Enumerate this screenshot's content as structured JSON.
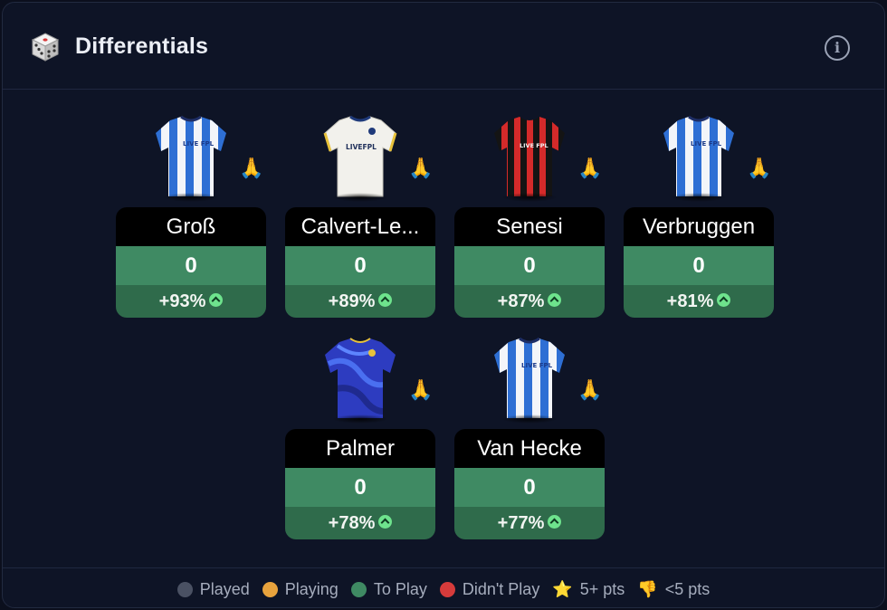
{
  "header": {
    "title": "Differentials",
    "icon": "dice-icon",
    "info_label": "i"
  },
  "players": [
    {
      "name": "Groß",
      "points": "0",
      "change": "+93%",
      "kit": "blue-white-stripes",
      "badge": "🙏"
    },
    {
      "name": "Calvert-Le...",
      "points": "0",
      "change": "+89%",
      "kit": "white",
      "badge": "🙏"
    },
    {
      "name": "Senesi",
      "points": "0",
      "change": "+87%",
      "kit": "red-black-stripes",
      "badge": "🙏"
    },
    {
      "name": "Verbruggen",
      "points": "0",
      "change": "+81%",
      "kit": "blue-white-stripes",
      "badge": "🙏"
    },
    {
      "name": "Palmer",
      "points": "0",
      "change": "+78%",
      "kit": "royal-blue",
      "badge": "🙏"
    },
    {
      "name": "Van Hecke",
      "points": "0",
      "change": "+77%",
      "kit": "blue-white-stripes",
      "badge": "🙏"
    }
  ],
  "kit_text": {
    "brighton": "LIVE FPL",
    "leeds": "LIVEFPL",
    "bournemouth": "LIVE FPL"
  },
  "legend": [
    {
      "label": "Played",
      "color": "#4a5163"
    },
    {
      "label": "Playing",
      "color": "#e8a33d"
    },
    {
      "label": "To Play",
      "color": "#3f8a63"
    },
    {
      "label": "Didn't Play",
      "color": "#d63b3b"
    },
    {
      "label": "5+ pts",
      "icon": "⭐"
    },
    {
      "label": "<5 pts",
      "icon": "👎"
    }
  ],
  "colors": {
    "card_points_bg": "#3f8a63",
    "card_change_bg": "#2f6b4b",
    "up_icon": "#6ee38d",
    "panel_bg": "#0e1426"
  }
}
